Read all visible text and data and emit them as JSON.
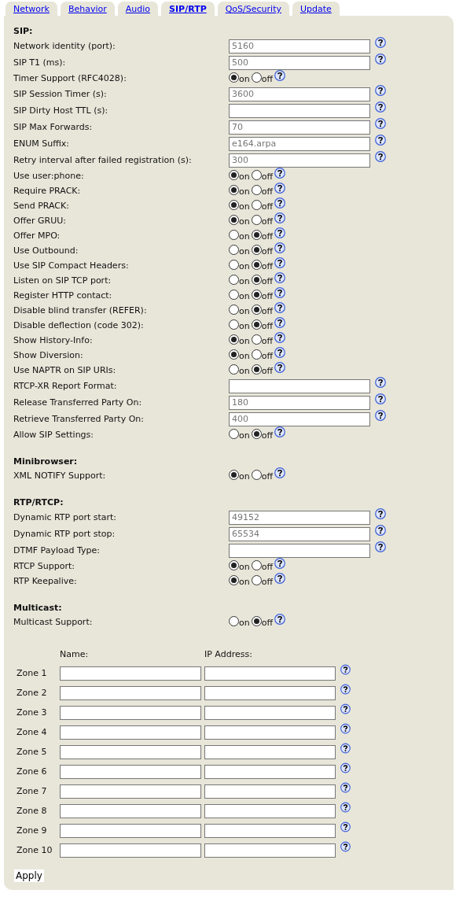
{
  "tabs": [
    {
      "label": "Network",
      "selected": false
    },
    {
      "label": "Behavior",
      "selected": false
    },
    {
      "label": "Audio",
      "selected": false
    },
    {
      "label": "SIP/RTP",
      "selected": true
    },
    {
      "label": "QoS/Security",
      "selected": false
    },
    {
      "label": "Update",
      "selected": false
    }
  ],
  "sections": [
    {
      "heading": "SIP:",
      "rows": [
        {
          "label": "Network identity (port):",
          "kind": "text",
          "value": "5160"
        },
        {
          "label": "SIP T1 (ms):",
          "kind": "text",
          "value": "500"
        },
        {
          "label": "Timer Support (RFC4028):",
          "kind": "radio",
          "on": true,
          "on_label": "on",
          "off_label": "off"
        },
        {
          "label": "SIP Session Timer (s):",
          "kind": "text",
          "value": "3600"
        },
        {
          "label": "SIP Dirty Host TTL (s):",
          "kind": "text"
        },
        {
          "label": "SIP Max Forwards:",
          "kind": "text",
          "value": "70"
        },
        {
          "label": "ENUM Suffix:",
          "kind": "text",
          "value": "e164.arpa"
        },
        {
          "label": "Retry interval after failed registration (s):",
          "kind": "text",
          "value": "300"
        },
        {
          "label": "Use user:phone:",
          "kind": "radio",
          "on": true,
          "on_label": "on",
          "off_label": "off"
        },
        {
          "label": "Require PRACK:",
          "kind": "radio",
          "on": true,
          "on_label": "on",
          "off_label": "off"
        },
        {
          "label": "Send PRACK:",
          "kind": "radio",
          "on": true,
          "on_label": "on",
          "off_label": "off"
        },
        {
          "label": "Offer GRUU:",
          "kind": "radio",
          "on": true,
          "on_label": "on",
          "off_label": "off"
        },
        {
          "label": "Offer MPO:",
          "kind": "radio",
          "on": false,
          "on_label": "on",
          "off_label": "off"
        },
        {
          "label": "Use Outbound:",
          "kind": "radio",
          "on": false,
          "on_label": "on",
          "off_label": "off"
        },
        {
          "label": "Use SIP Compact Headers:",
          "kind": "radio",
          "on": false,
          "on_label": "on",
          "off_label": "off"
        },
        {
          "label": "Listen on SIP TCP port:",
          "kind": "radio",
          "on": false,
          "on_label": "on",
          "off_label": "off"
        },
        {
          "label": "Register HTTP contact:",
          "kind": "radio",
          "on": false,
          "on_label": "on",
          "off_label": "off"
        },
        {
          "label": "Disable blind transfer (REFER):",
          "kind": "radio",
          "on": false,
          "on_label": "on",
          "off_label": "off"
        },
        {
          "label": "Disable deflection (code 302):",
          "kind": "radio",
          "on": false,
          "on_label": "on",
          "off_label": "off"
        },
        {
          "label": "Show History-Info:",
          "kind": "radio",
          "on": true,
          "on_label": "on",
          "off_label": "off"
        },
        {
          "label": "Show Diversion:",
          "kind": "radio",
          "on": true,
          "on_label": "on",
          "off_label": "off"
        },
        {
          "label": "Use NAPTR on SIP URIs:",
          "kind": "radio",
          "on": false,
          "on_label": "on",
          "off_label": "off"
        },
        {
          "label": "RTCP-XR Report Format:",
          "kind": "text"
        },
        {
          "label": "Release Transferred Party On:",
          "kind": "text",
          "value": "180"
        },
        {
          "label": "Retrieve Transferred Party On:",
          "kind": "text",
          "value": "400"
        },
        {
          "label": "Allow SIP Settings:",
          "kind": "radio",
          "on": false,
          "on_label": "on",
          "off_label": "off"
        }
      ]
    },
    {
      "heading": "Minibrowser:",
      "rows": [
        {
          "label": "XML NOTIFY Support:",
          "kind": "radio",
          "on": true,
          "on_label": "on",
          "off_label": "off"
        }
      ]
    },
    {
      "heading": "RTP/RTCP:",
      "rows": [
        {
          "label": "Dynamic RTP port start:",
          "kind": "text",
          "value": "49152"
        },
        {
          "label": "Dynamic RTP port stop:",
          "kind": "text",
          "value": "65534"
        },
        {
          "label": "DTMF Payload Type:",
          "kind": "text"
        },
        {
          "label": "RTCP Support:",
          "kind": "radio",
          "on": true,
          "on_label": "on",
          "off_label": "off"
        },
        {
          "label": "RTP Keepalive:",
          "kind": "radio",
          "on": true,
          "on_label": "on",
          "off_label": "off"
        }
      ]
    },
    {
      "heading": "Multicast:",
      "rows": [
        {
          "label": "Multicast Support:",
          "kind": "radio",
          "on": false,
          "on_label": "on",
          "off_label": "off"
        }
      ]
    }
  ],
  "zones": {
    "columns": [
      "Name:",
      "IP Address:"
    ],
    "rows": [
      {
        "label": "Zone 1"
      },
      {
        "label": "Zone 2"
      },
      {
        "label": "Zone 3"
      },
      {
        "label": "Zone 4"
      },
      {
        "label": "Zone 5"
      },
      {
        "label": "Zone 6"
      },
      {
        "label": "Zone 7"
      },
      {
        "label": "Zone 8"
      },
      {
        "label": "Zone 9"
      },
      {
        "label": "Zone 10"
      }
    ]
  },
  "apply": "Apply"
}
